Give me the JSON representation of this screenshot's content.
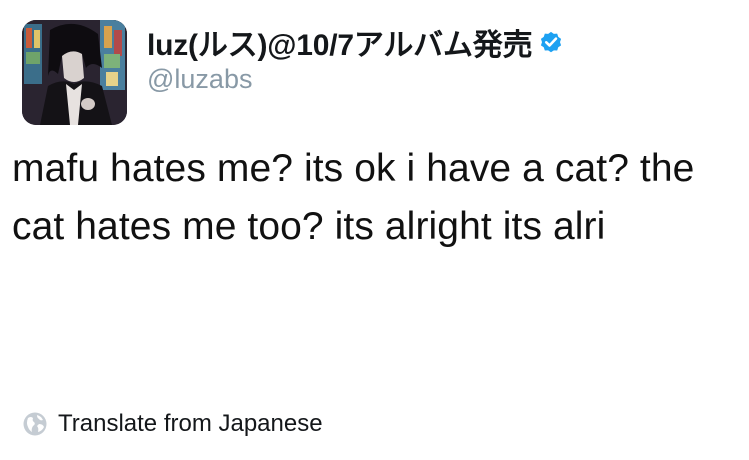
{
  "tweet": {
    "author": {
      "display_name": "luz(ルス)@10/7アルバム発売",
      "handle": "@luzabs",
      "verified": true,
      "verified_color": "#1da1f2",
      "avatar_icon": "profile-photo"
    },
    "text": "mafu hates me? its ok i have a cat? the cat hates me too? its alright its alri",
    "translate": {
      "icon": "globe-icon",
      "label": "Translate from Japanese"
    }
  },
  "colors": {
    "text": "#14171a",
    "secondary": "#8899a6",
    "accent": "#1da1f2"
  }
}
